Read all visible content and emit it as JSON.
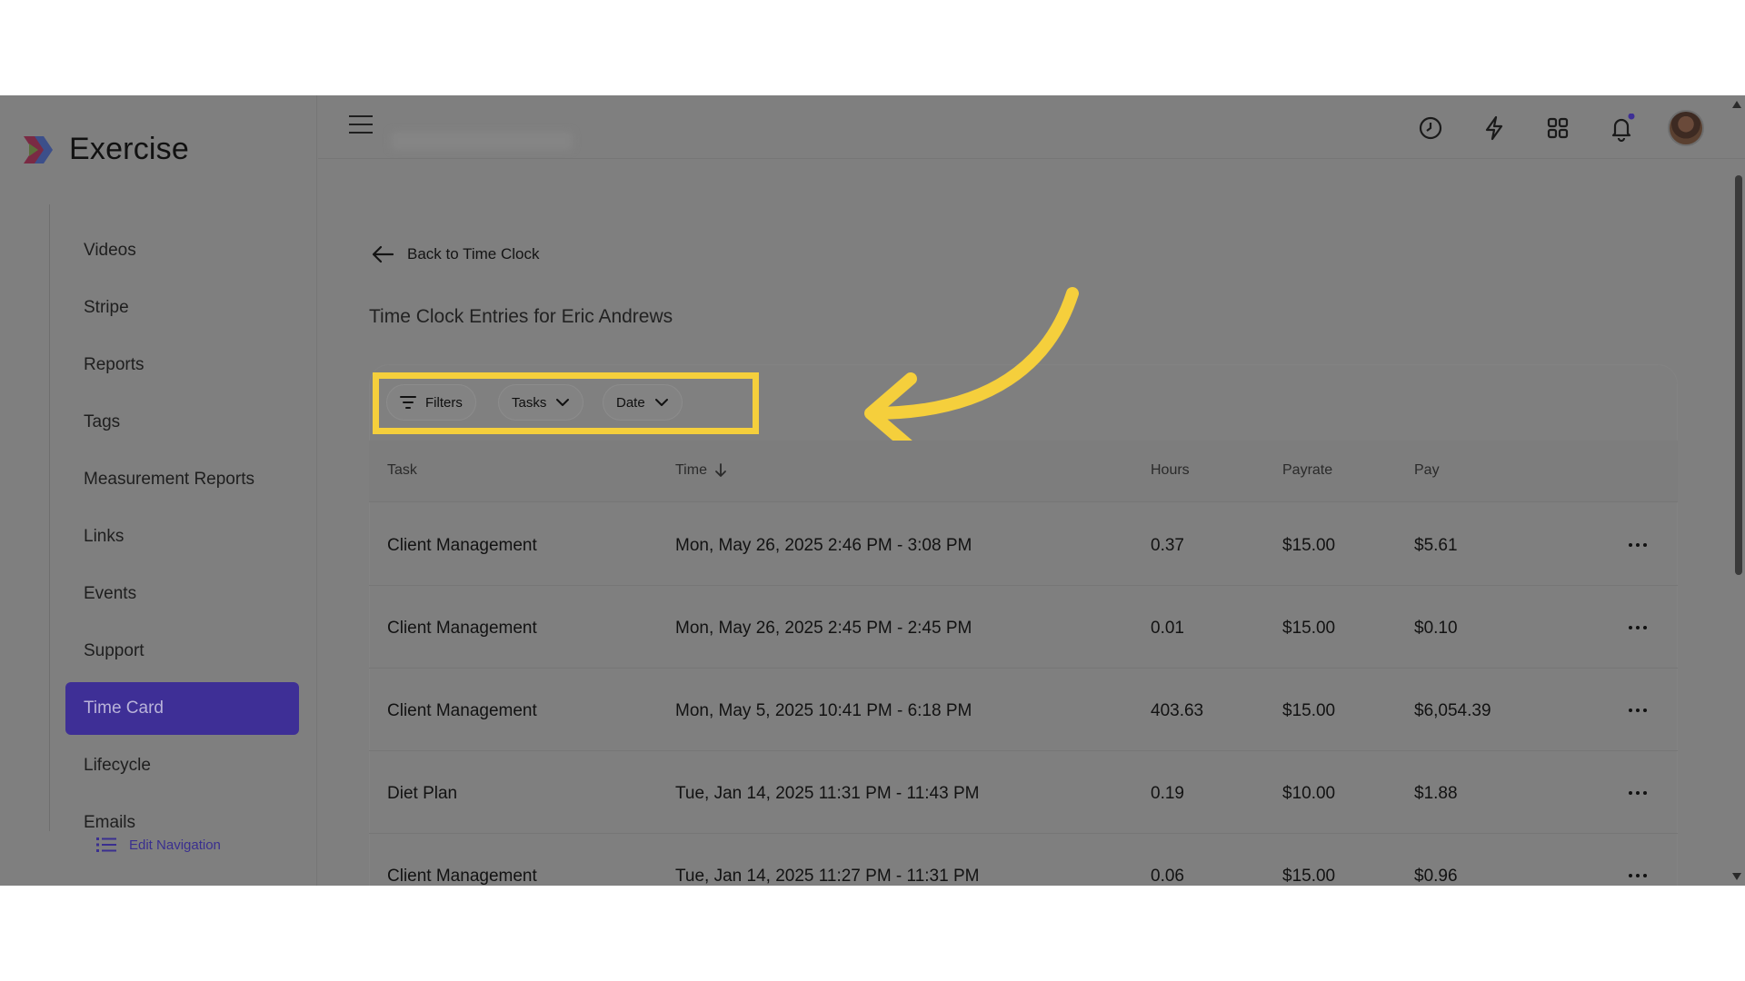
{
  "app": {
    "name": "Exercise"
  },
  "colors": {
    "accent": "#3e2f96",
    "highlight": "#f5cf3c",
    "arrow": "#f5cf3c",
    "overlay": "#7f7f7f"
  },
  "sidebar": {
    "items": [
      {
        "label": "Videos",
        "active": false
      },
      {
        "label": "Stripe",
        "active": false
      },
      {
        "label": "Reports",
        "active": false
      },
      {
        "label": "Tags",
        "active": false
      },
      {
        "label": "Measurement Reports",
        "active": false
      },
      {
        "label": "Links",
        "active": false
      },
      {
        "label": "Events",
        "active": false
      },
      {
        "label": "Support",
        "active": false
      },
      {
        "label": "Time Card",
        "active": true
      },
      {
        "label": "Lifecycle",
        "active": false
      },
      {
        "label": "Emails",
        "active": false
      }
    ],
    "edit_nav_label": "Edit Navigation"
  },
  "header": {
    "icons": [
      "clock-icon",
      "bolt-icon",
      "apps-grid-icon",
      "bell-icon"
    ],
    "notification_dot": true
  },
  "main": {
    "back_label": "Back to Time Clock",
    "title": "Time Clock Entries for Eric Andrews",
    "filters": {
      "filters_label": "Filters",
      "tasks_label": "Tasks",
      "date_label": "Date"
    },
    "table": {
      "headers": {
        "task": "Task",
        "time": "Time",
        "hours": "Hours",
        "payrate": "Payrate",
        "pay": "Pay"
      },
      "rows": [
        {
          "task": "Client Management",
          "time": "Mon, May 26, 2025 2:46 PM - 3:08 PM",
          "hours": "0.37",
          "payrate": "$15.00",
          "pay": "$5.61"
        },
        {
          "task": "Client Management",
          "time": "Mon, May 26, 2025 2:45 PM - 2:45 PM",
          "hours": "0.01",
          "payrate": "$15.00",
          "pay": "$0.10"
        },
        {
          "task": "Client Management",
          "time": "Mon, May 5, 2025 10:41 PM - 6:18 PM",
          "hours": "403.63",
          "payrate": "$15.00",
          "pay": "$6,054.39"
        },
        {
          "task": "Diet Plan",
          "time": "Tue, Jan 14, 2025 11:31 PM - 11:43 PM",
          "hours": "0.19",
          "payrate": "$10.00",
          "pay": "$1.88"
        },
        {
          "task": "Client Management",
          "time": "Tue, Jan 14, 2025 11:27 PM - 11:31 PM",
          "hours": "0.06",
          "payrate": "$15.00",
          "pay": "$0.96"
        }
      ]
    }
  }
}
